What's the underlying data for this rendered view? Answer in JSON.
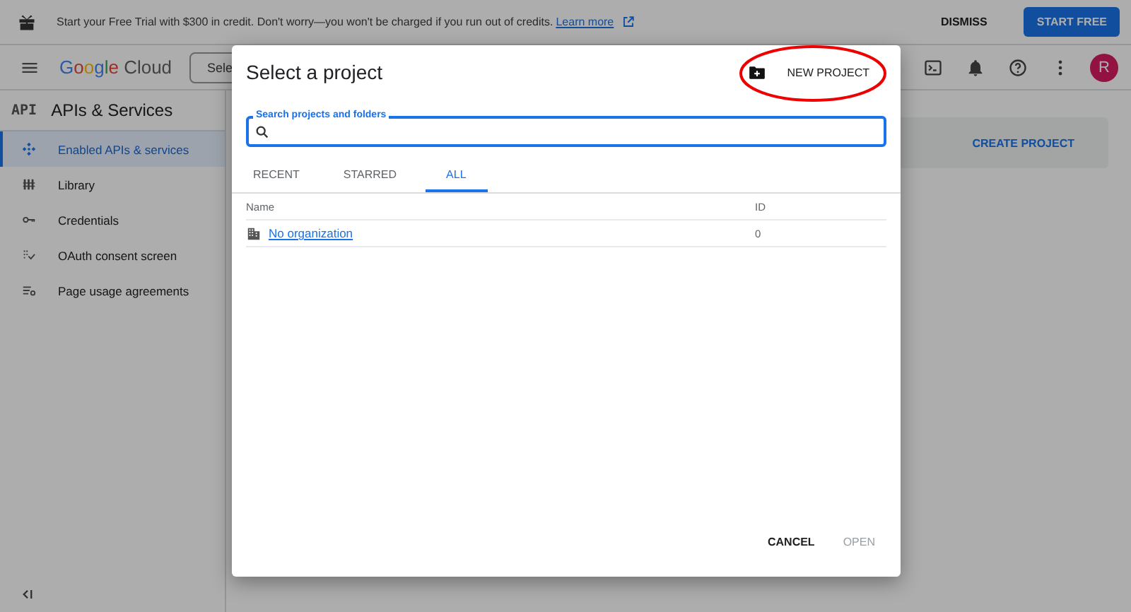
{
  "banner": {
    "text": "Start your Free Trial with $300 in credit. Don't worry—you won't be charged if you run out of credits.",
    "link": "Learn more",
    "dismiss": "DISMISS",
    "start": "START FREE"
  },
  "header": {
    "logo": "Google",
    "product": "Cloud",
    "project_selector": "Sele",
    "avatar": "R"
  },
  "sidebar": {
    "badge": "API",
    "title": "APIs & Services",
    "items": [
      {
        "label": "Enabled APIs & services",
        "kind": "apis",
        "selected": true
      },
      {
        "label": "Library",
        "kind": "library",
        "selected": false
      },
      {
        "label": "Credentials",
        "kind": "key",
        "selected": false
      },
      {
        "label": "OAuth consent screen",
        "kind": "consent",
        "selected": false
      },
      {
        "label": "Page usage agreements",
        "kind": "agreements",
        "selected": false
      }
    ]
  },
  "content": {
    "create_project": "CREATE PROJECT"
  },
  "dialog": {
    "title": "Select a project",
    "new_project": "NEW PROJECT",
    "search": {
      "label": "Search projects and folders"
    },
    "tabs": [
      {
        "label": "RECENT",
        "selected": false
      },
      {
        "label": "STARRED",
        "selected": false
      },
      {
        "label": "ALL",
        "selected": true
      }
    ],
    "columns": [
      "Name",
      "ID"
    ],
    "rows": [
      {
        "name": "No organization",
        "id": "0"
      }
    ],
    "buttons": [
      {
        "label": "CANCEL",
        "disabled": false
      },
      {
        "label": "OPEN",
        "disabled": true
      }
    ]
  }
}
